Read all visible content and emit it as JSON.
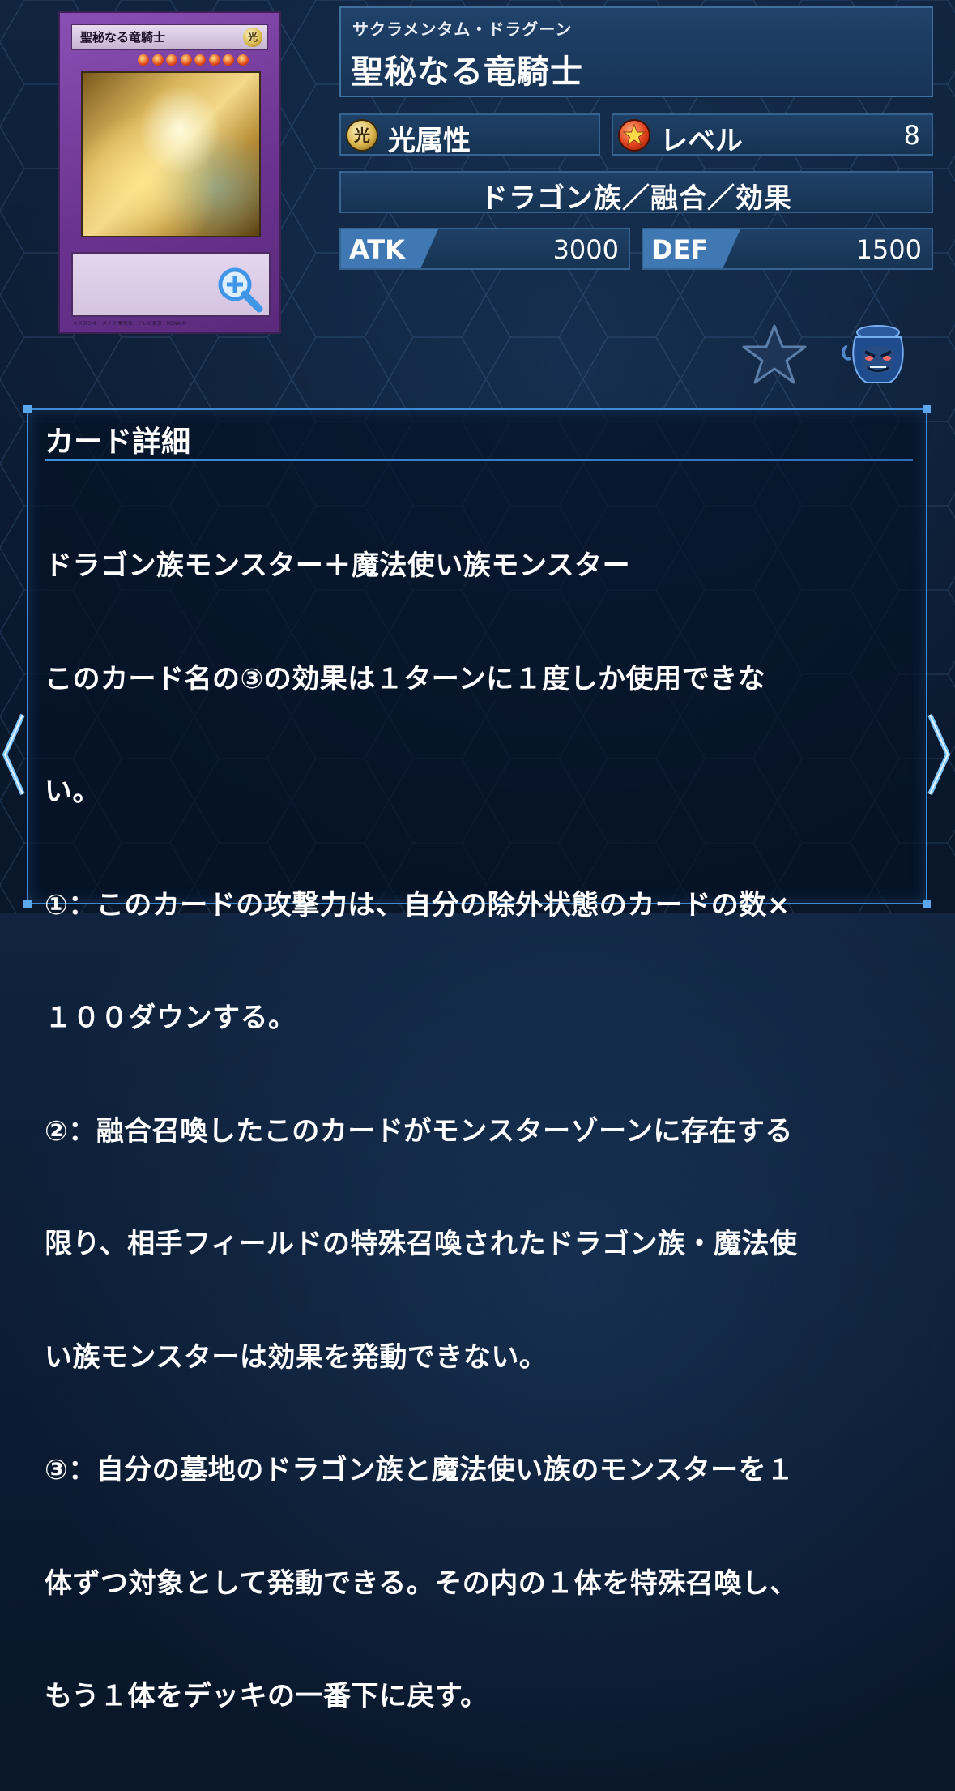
{
  "card": {
    "image_title": "聖秘なる竜騎士",
    "image_attribute_glyph": "光",
    "image_level_stars": 8,
    "zoom_icon": "zoom-in-icon",
    "footer_text": "©スタジオ・ダイス/集英社・テレビ東京・KONAMI"
  },
  "header": {
    "ruby": "サクラメンタム・ドラグーン",
    "name": "聖秘なる竜騎士"
  },
  "stats": {
    "attribute_glyph": "光",
    "attribute_label": "光属性",
    "level_label": "レベル",
    "level_value": "8",
    "type_line": "ドラゴン族／融合／効果",
    "atk_label": "ATK",
    "atk_value": "3000",
    "def_label": "DEF",
    "def_value": "1500"
  },
  "actions": {
    "favorite_icon": "star-icon",
    "pot_icon": "pot-of-greed-icon"
  },
  "detail": {
    "title": "カード詳細",
    "lines": [
      "ドラゴン族モンスター＋魔法使い族モンスター",
      "このカード名の③の効果は１ターンに１度しか使用できな",
      "い。",
      "①：このカードの攻撃力は、自分の除外状態のカードの数×",
      "１００ダウンする。",
      "②：融合召喚したこのカードがモンスターゾーンに存在する",
      "限り、相手フィールドの特殊召喚されたドラゴン族・魔法使",
      "い族モンスターは効果を発動できない。",
      "③：自分の墓地のドラゴン族と魔法使い族のモンスターを１",
      "体ずつ対象として発動できる。その内の１体を特殊召喚し、",
      "もう１体をデッキの一番下に戻す。"
    ]
  },
  "nav": {
    "prev_icon": "chevron-left-icon",
    "next_icon": "chevron-right-icon"
  },
  "colors": {
    "panel_border": "#3d8ad6",
    "atk_accent": "#3f78b3",
    "card_frame": "#6b3391"
  }
}
